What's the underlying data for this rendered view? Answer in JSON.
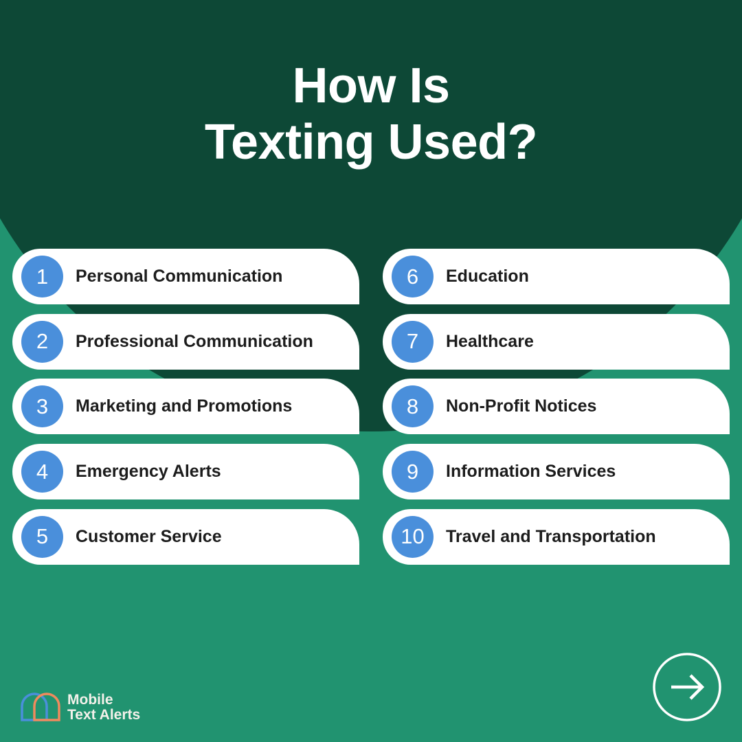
{
  "title": {
    "line1": "How Is",
    "line2": "Texting Used?"
  },
  "colors": {
    "background": "#219370",
    "dark_green": "#0d4836",
    "badge_blue": "#4a8fdb",
    "card": "#ffffff"
  },
  "items": [
    {
      "number": "1",
      "label": "Personal Communication"
    },
    {
      "number": "2",
      "label": "Professional Communication"
    },
    {
      "number": "3",
      "label": "Marketing and Promotions"
    },
    {
      "number": "4",
      "label": "Emergency Alerts"
    },
    {
      "number": "5",
      "label": "Customer Service"
    },
    {
      "number": "6",
      "label": "Education"
    },
    {
      "number": "7",
      "label": "Healthcare"
    },
    {
      "number": "8",
      "label": "Non-Profit Notices"
    },
    {
      "number": "9",
      "label": "Information Services"
    },
    {
      "number": "10",
      "label": "Travel and Transportation"
    }
  ],
  "brand": {
    "line1": "Mobile",
    "line2": "Text Alerts",
    "logo_icon": "overlapping-speech-bubbles-icon"
  },
  "next_button": {
    "icon": "arrow-right-circle-icon"
  }
}
